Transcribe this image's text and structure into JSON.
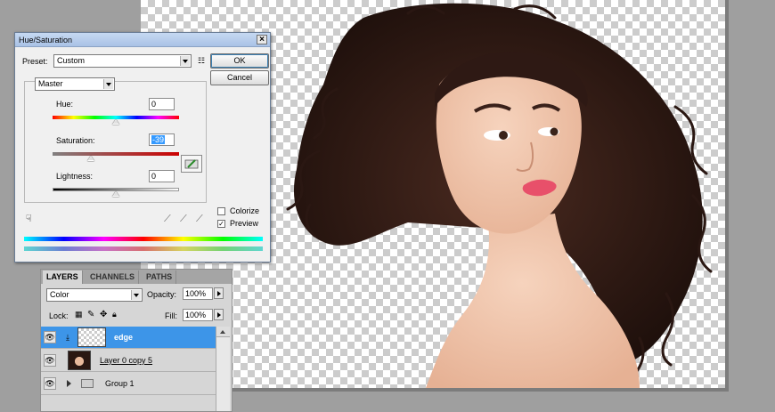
{
  "dialog": {
    "title": "Hue/Saturation",
    "close_glyph": "×",
    "preset_label": "Preset:",
    "preset_value": "Custom",
    "ok_label": "OK",
    "cancel_label": "Cancel",
    "channel_value": "Master",
    "hue_label": "Hue:",
    "hue_value": "0",
    "hue_level": 0.5,
    "saturation_label": "Saturation:",
    "saturation_value": "-39",
    "saturation_level": 0.305,
    "lightness_label": "Lightness:",
    "lightness_value": "0",
    "lightness_level": 0.5,
    "colorize_label": "Colorize",
    "colorize_checked": false,
    "preview_label": "Preview",
    "preview_checked": true,
    "preview_check_glyph": "✓"
  },
  "layers_panel": {
    "tabs": [
      "LAYERS",
      "CHANNELS",
      "PATHS"
    ],
    "active_tab": "LAYERS",
    "blend_mode": "Color",
    "opacity_label": "Opacity:",
    "opacity_value": "100%",
    "lock_label": "Lock:",
    "fill_label": "Fill:",
    "fill_value": "100%",
    "layers": [
      {
        "name": "edge",
        "selected": true,
        "visible": true
      },
      {
        "name": "Layer 0 copy 5",
        "selected": false,
        "visible": true
      },
      {
        "name": "Group 1",
        "selected": false,
        "visible": true
      }
    ]
  },
  "colors": {
    "selection": "#3d95e8",
    "dialog_bg": "#f0f0f0",
    "hair": "#2a1712",
    "skin": "#f2c7ab"
  },
  "icons": {
    "eye": "eye-icon",
    "link": "link-icon",
    "folder": "folder-icon",
    "expand": "expand-triangle-icon",
    "eyedropper": "eyedropper-icon",
    "hand": "hand-target-icon"
  }
}
